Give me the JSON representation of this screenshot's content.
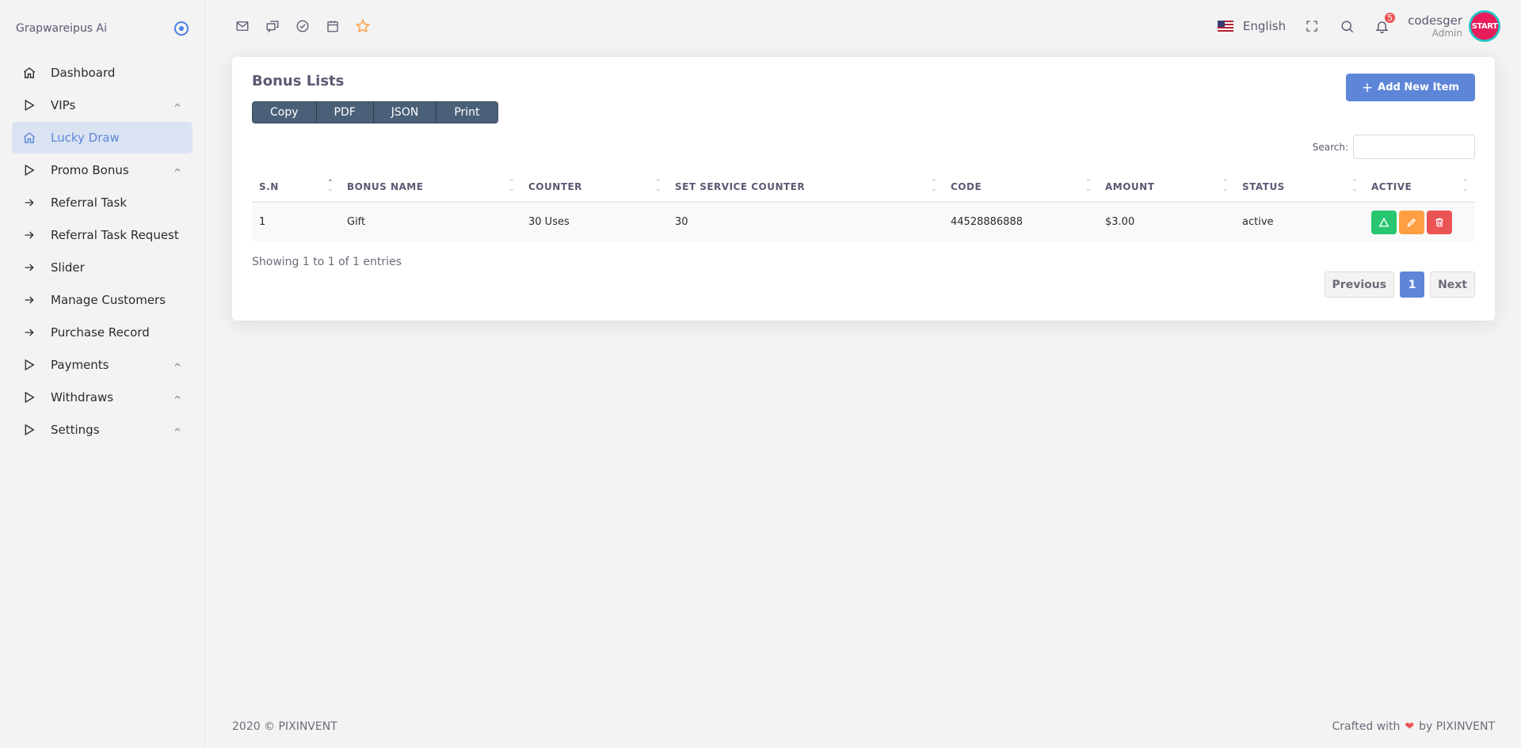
{
  "brand": {
    "name": "Grapwareipus Ai"
  },
  "sidebar": {
    "items": [
      {
        "label": "Dashboard",
        "icon": "home-icon",
        "chevron": false,
        "active": false
      },
      {
        "label": "VIPs",
        "icon": "play-icon",
        "chevron": true,
        "active": false
      },
      {
        "label": "Lucky Draw",
        "icon": "home-icon",
        "chevron": false,
        "active": true
      },
      {
        "label": "Promo Bonus",
        "icon": "play-icon",
        "chevron": true,
        "active": false
      },
      {
        "label": "Referral Task",
        "icon": "arrow-right-icon",
        "chevron": false,
        "active": false
      },
      {
        "label": "Referral Task Request",
        "icon": "arrow-right-icon",
        "chevron": false,
        "active": false
      },
      {
        "label": "Slider",
        "icon": "arrow-right-icon",
        "chevron": false,
        "active": false
      },
      {
        "label": "Manage Customers",
        "icon": "arrow-right-icon",
        "chevron": false,
        "active": false
      },
      {
        "label": "Purchase Record",
        "icon": "arrow-right-icon",
        "chevron": false,
        "active": false
      },
      {
        "label": "Payments",
        "icon": "play-icon",
        "chevron": true,
        "active": false
      },
      {
        "label": "Withdraws",
        "icon": "play-icon",
        "chevron": true,
        "active": false
      },
      {
        "label": "Settings",
        "icon": "play-icon",
        "chevron": true,
        "active": false
      }
    ]
  },
  "header": {
    "bookmarks": [
      "mail-icon",
      "chat-icon",
      "check-circle-icon",
      "calendar-icon",
      "star-icon"
    ],
    "language": "English",
    "notification_count": "5",
    "user_name": "codesger",
    "user_role": "Admin",
    "avatar_text": "START"
  },
  "card": {
    "title": "Bonus Lists",
    "export_buttons": [
      "Copy",
      "PDF",
      "JSON",
      "Print"
    ],
    "add_button": "Add New Item",
    "search_label": "Search:",
    "search_value": ""
  },
  "table": {
    "columns": [
      "S.N",
      "BONUS NAME",
      "COUNTER",
      "SET SERVICE COUNTER",
      "CODE",
      "AMOUNT",
      "STATUS",
      "ACTIVE"
    ],
    "rows": [
      {
        "sn": "1",
        "name": "Gift",
        "counter": "30 Uses",
        "set_service_counter": "30",
        "code": "44528886888",
        "amount": "$3.00",
        "status": "active"
      }
    ]
  },
  "pagination": {
    "info": "Showing 1 to 1 of 1 entries",
    "previous": "Previous",
    "current": "1",
    "next": "Next"
  },
  "footer": {
    "left": "2020 © PIXINVENT",
    "right_prefix": "Crafted with",
    "right_suffix": "by PIXINVENT"
  },
  "colors": {
    "primary": "#5e86d8",
    "success": "#28c76f",
    "warning": "#ff9f43",
    "danger": "#ea5455",
    "button_dark": "#4a5f78"
  }
}
